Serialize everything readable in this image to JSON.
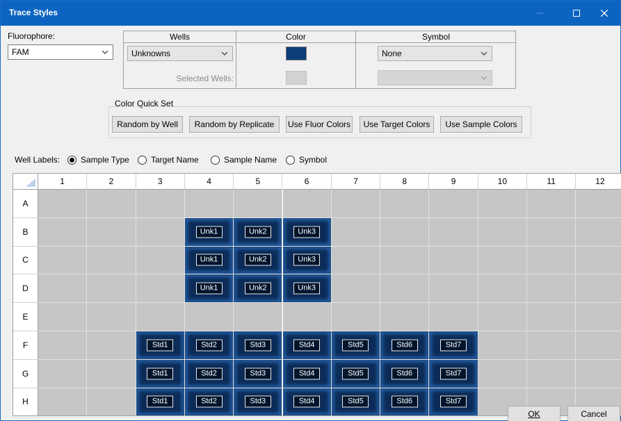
{
  "window": {
    "title": "Trace Styles"
  },
  "fluorophore": {
    "label": "Fluorophore:",
    "value": "FAM"
  },
  "style_grid": {
    "headers": {
      "wells": "Wells",
      "color": "Color",
      "symbol": "Symbol"
    },
    "row1": {
      "wells_value": "Unknowns",
      "color": "#0b3d7a",
      "symbol_value": "None"
    },
    "row2": {
      "wells_label": "Selected Wells:",
      "color": "#d2d2d2",
      "symbol_value": ""
    }
  },
  "quick_set": {
    "title": "Color Quick Set",
    "buttons": [
      "Random by Well",
      "Random by Replicate",
      "Use Fluor Colors",
      "Use Target Colors",
      "Use Sample Colors"
    ]
  },
  "well_labels": {
    "label": "Well Labels:",
    "options": [
      "Sample Type",
      "Target Name",
      "Sample Name",
      "Symbol"
    ],
    "selected": "Sample Type"
  },
  "plate": {
    "columns": [
      "1",
      "2",
      "3",
      "4",
      "5",
      "6",
      "7",
      "8",
      "9",
      "10",
      "11",
      "12"
    ],
    "rows": [
      "A",
      "B",
      "C",
      "D",
      "E",
      "F",
      "G",
      "H"
    ],
    "wells": {
      "B": {
        "4": "Unk1",
        "5": "Unk2",
        "6": "Unk3"
      },
      "C": {
        "4": "Unk1",
        "5": "Unk2",
        "6": "Unk3"
      },
      "D": {
        "4": "Unk1",
        "5": "Unk2",
        "6": "Unk3"
      },
      "F": {
        "3": "Std1",
        "4": "Std2",
        "5": "Std3",
        "6": "Std4",
        "7": "Std5",
        "8": "Std6",
        "9": "Std7"
      },
      "G": {
        "3": "Std1",
        "4": "Std2",
        "5": "Std3",
        "6": "Std4",
        "7": "Std5",
        "8": "Std6",
        "9": "Std7"
      },
      "H": {
        "3": "Std1",
        "4": "Std2",
        "5": "Std3",
        "6": "Std4",
        "7": "Std5",
        "8": "Std6",
        "9": "Std7"
      }
    }
  },
  "footer": {
    "ok": "OK",
    "cancel": "Cancel"
  }
}
